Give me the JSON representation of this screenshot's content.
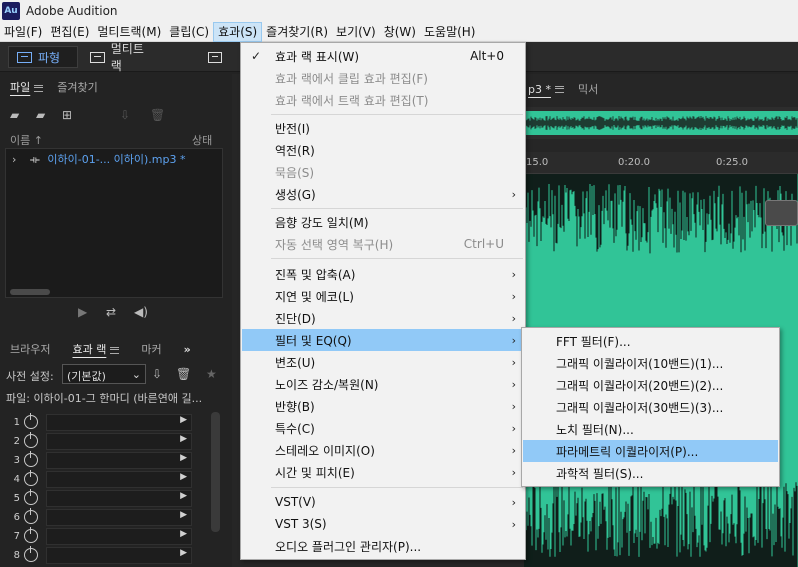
{
  "window": {
    "app_icon": "Au",
    "title": "Adobe Audition"
  },
  "menubar": [
    "파일(F)",
    "편집(E)",
    "멀티트랙(M)",
    "클립(C)",
    "효과(S)",
    "즐겨찾기(R)",
    "보기(V)",
    "창(W)",
    "도움말(H)"
  ],
  "toolbar": {
    "waveform": "파형",
    "multitrack": "멀티트랙"
  },
  "files_panel": {
    "tabs": [
      "파일",
      "즐겨찾기"
    ],
    "col_name": "이름 ↑",
    "col_status": "상태",
    "file_item": "이하이-01-... 이하이).mp3 *"
  },
  "effects_panel": {
    "tabs": [
      "브라우저",
      "효과 랙",
      "마커"
    ],
    "more": "»",
    "preset_label": "사전 설정:",
    "preset_value": "(기본값)",
    "file_line": "파일: 이하이-01-그 한마디 (바른연애 길...",
    "slots": [
      "1",
      "2",
      "3",
      "4",
      "5",
      "6",
      "7",
      "8"
    ]
  },
  "editor": {
    "tab_file": "p3 *",
    "tab_mixer": "믹서",
    "ruler": [
      "15.0",
      "0:20.0",
      "0:25.0"
    ]
  },
  "effects_menu": {
    "items": [
      {
        "label": "효과 랙 표시(W)",
        "shortcut": "Alt+0",
        "checked": true
      },
      {
        "label": "효과 랙에서 클립 효과 편집(F)",
        "disabled": true
      },
      {
        "label": "효과 랙에서 트랙 효과 편집(T)",
        "disabled": true
      },
      {
        "label": "반전(I)"
      },
      {
        "label": "역전(R)"
      },
      {
        "label": "묵음(S)",
        "disabled": true
      },
      {
        "label": "생성(G)",
        "sub": true
      },
      {
        "label": "음향 강도 일치(M)"
      },
      {
        "label": "자동 선택 영역 복구(H)",
        "shortcut": "Ctrl+U",
        "disabled": true
      },
      {
        "label": "진폭 및 압축(A)",
        "sub": true
      },
      {
        "label": "지연 및 에코(L)",
        "sub": true
      },
      {
        "label": "진단(D)",
        "sub": true
      },
      {
        "label": "필터 및 EQ(Q)",
        "sub": true,
        "highlighted": true
      },
      {
        "label": "변조(U)",
        "sub": true
      },
      {
        "label": "노이즈 감소/복원(N)",
        "sub": true
      },
      {
        "label": "반향(B)",
        "sub": true
      },
      {
        "label": "특수(C)",
        "sub": true
      },
      {
        "label": "스테레오 이미지(O)",
        "sub": true
      },
      {
        "label": "시간 및 피치(E)",
        "sub": true
      },
      {
        "label": "VST(V)",
        "sub": true
      },
      {
        "label": "VST 3(S)",
        "sub": true
      },
      {
        "label": "오디오 플러그인 관리자(P)..."
      }
    ],
    "submenu_arrow": "›",
    "check_mark": "✓"
  },
  "filter_submenu": {
    "items": [
      {
        "label": "FFT 필터(F)..."
      },
      {
        "label": "그래픽 이퀄라이저(10밴드)(1)..."
      },
      {
        "label": "그래픽 이퀄라이저(20밴드)(2)..."
      },
      {
        "label": "그래픽 이퀄라이저(30밴드)(3)..."
      },
      {
        "label": "노치 필터(N)..."
      },
      {
        "label": "파라메트릭 이퀄라이저(P)...",
        "highlighted": true
      },
      {
        "label": "과학적 필터(S)..."
      }
    ]
  },
  "colors": {
    "waveform": "#31c497",
    "highlight": "#91c9f7",
    "link_blue": "#5da2f0"
  }
}
